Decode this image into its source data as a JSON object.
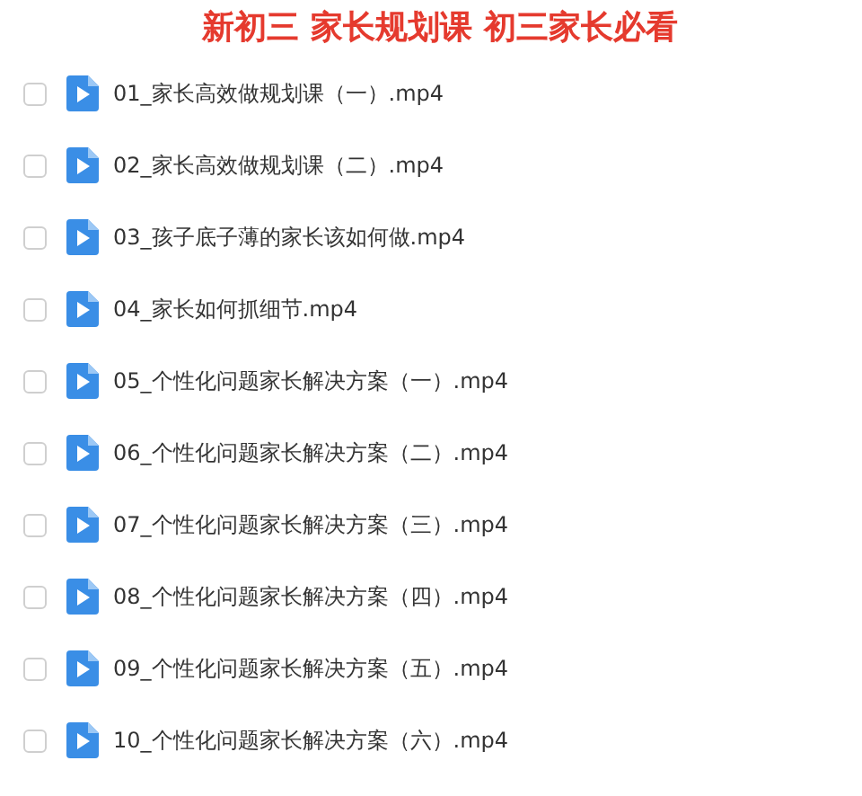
{
  "title": "新初三 家长规划课 初三家长必看",
  "files": [
    {
      "name": "01_家长高效做规划课（一）.mp4",
      "checked": false
    },
    {
      "name": "02_家长高效做规划课（二）.mp4",
      "checked": false
    },
    {
      "name": "03_孩子底子薄的家长该如何做.mp4",
      "checked": false
    },
    {
      "name": "04_家长如何抓细节.mp4",
      "checked": false
    },
    {
      "name": "05_个性化问题家长解决方案（一）.mp4",
      "checked": false
    },
    {
      "name": "06_个性化问题家长解决方案（二）.mp4",
      "checked": false
    },
    {
      "name": "07_个性化问题家长解决方案（三）.mp4",
      "checked": false
    },
    {
      "name": "08_个性化问题家长解决方案（四）.mp4",
      "checked": false
    },
    {
      "name": "09_个性化问题家长解决方案（五）.mp4",
      "checked": false
    },
    {
      "name": "10_个性化问题家长解决方案（六）.mp4",
      "checked": false
    }
  ]
}
